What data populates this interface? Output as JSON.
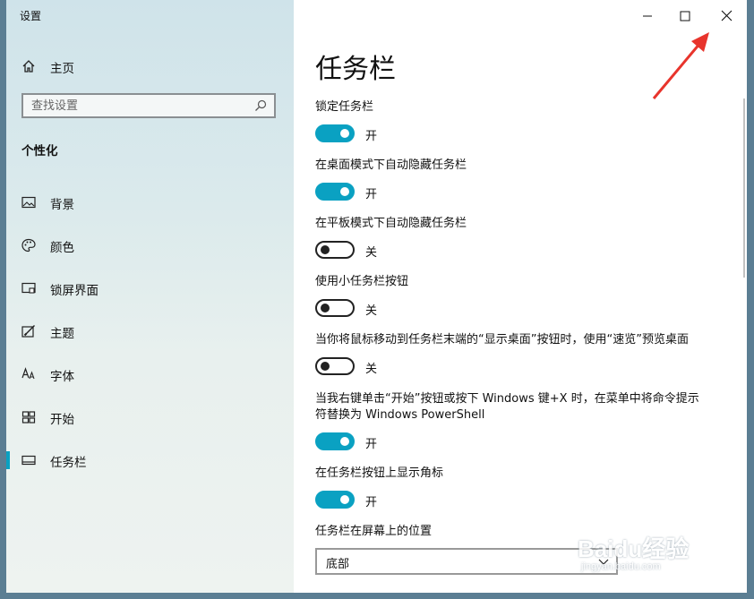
{
  "window": {
    "title": "设置"
  },
  "sidebar": {
    "home_label": "主页",
    "search_placeholder": "查找设置",
    "section_title": "个性化",
    "items": [
      {
        "label": "背景",
        "icon": "picture-icon"
      },
      {
        "label": "颜色",
        "icon": "palette-icon"
      },
      {
        "label": "锁屏界面",
        "icon": "lock-screen-icon"
      },
      {
        "label": "主题",
        "icon": "theme-icon"
      },
      {
        "label": "字体",
        "icon": "font-icon"
      },
      {
        "label": "开始",
        "icon": "start-icon"
      },
      {
        "label": "任务栏",
        "icon": "taskbar-icon",
        "active": true
      }
    ]
  },
  "main": {
    "title": "任务栏",
    "settings": [
      {
        "label": "锁定任务栏",
        "state": "开",
        "on": true
      },
      {
        "label": "在桌面模式下自动隐藏任务栏",
        "state": "开",
        "on": true
      },
      {
        "label": "在平板模式下自动隐藏任务栏",
        "state": "关",
        "on": false
      },
      {
        "label": "使用小任务栏按钮",
        "state": "关",
        "on": false
      },
      {
        "label": "当你将鼠标移动到任务栏末端的“显示桌面”按钮时，使用“速览”预览桌面",
        "state": "关",
        "on": false
      },
      {
        "label": "当我右键单击“开始”按钮或按下 Windows 键+X 时，在菜单中将命令提示符替换为 Windows PowerShell",
        "state": "开",
        "on": true
      },
      {
        "label": "在任务栏按钮上显示角标",
        "state": "开",
        "on": true
      }
    ],
    "position": {
      "label": "任务栏在屏幕上的位置",
      "value": "底部"
    }
  },
  "watermark": {
    "brand": "Baidu经验",
    "url": "jingyan.baidu.com"
  },
  "colors": {
    "accent": "#0aa1c2",
    "annotation_arrow": "#e8342c"
  }
}
